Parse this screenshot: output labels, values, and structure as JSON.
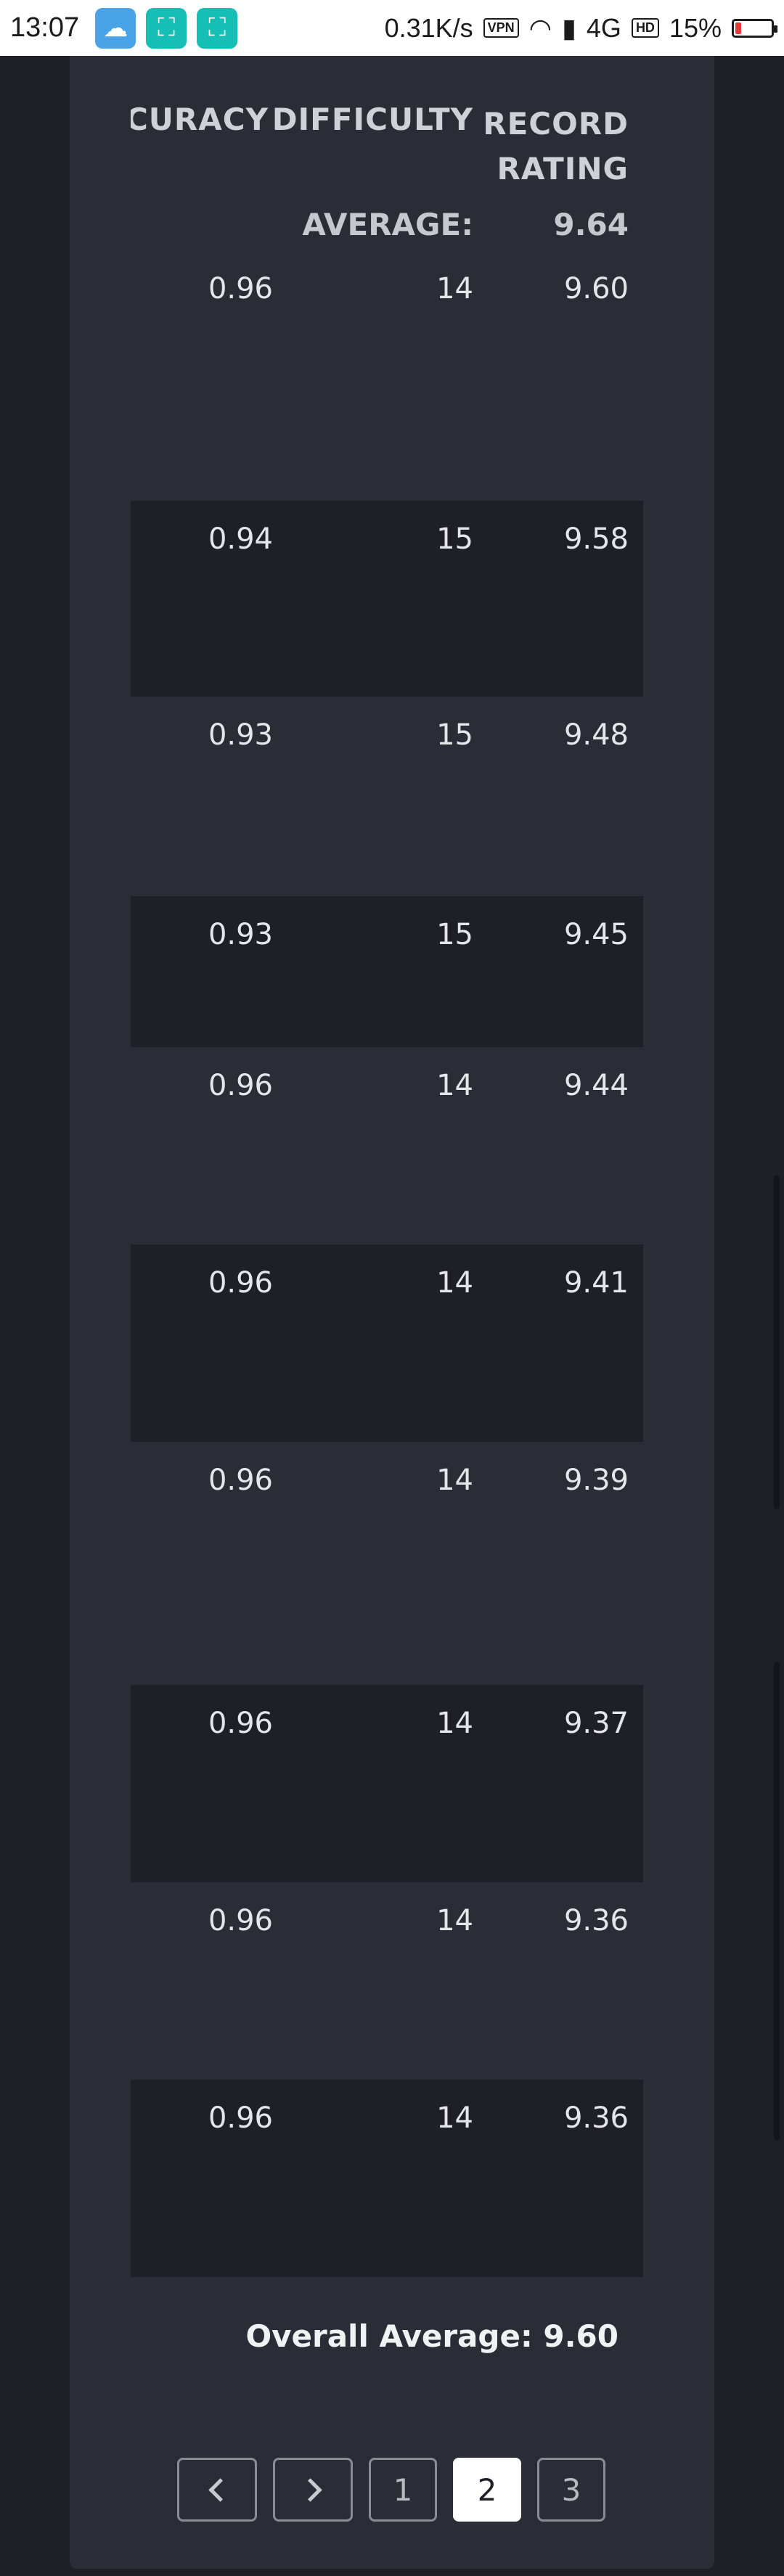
{
  "status_bar": {
    "time": "13:07",
    "speed": "0.31K/s",
    "vpn": "VPN",
    "network": "4G",
    "hd": "HD",
    "battery": "15%",
    "battery_level": 0.15
  },
  "table": {
    "headers": {
      "accuracy": "ACCURACY",
      "difficulty": "DIFFICULTY",
      "record_rating_line1": "RECORD",
      "record_rating_line2": "RATING"
    },
    "average": {
      "label": "AVERAGE:",
      "value": "9.64"
    },
    "rows": [
      {
        "accuracy": "0.96",
        "difficulty": "14",
        "rating": "9.60"
      },
      {
        "accuracy": "0.94",
        "difficulty": "15",
        "rating": "9.58"
      },
      {
        "accuracy": "0.93",
        "difficulty": "15",
        "rating": "9.48"
      },
      {
        "accuracy": "0.93",
        "difficulty": "15",
        "rating": "9.45"
      },
      {
        "accuracy": "0.96",
        "difficulty": "14",
        "rating": "9.44"
      },
      {
        "accuracy": "0.96",
        "difficulty": "14",
        "rating": "9.41"
      },
      {
        "accuracy": "0.96",
        "difficulty": "14",
        "rating": "9.39"
      },
      {
        "accuracy": "0.96",
        "difficulty": "14",
        "rating": "9.37"
      },
      {
        "accuracy": "0.96",
        "difficulty": "14",
        "rating": "9.36"
      },
      {
        "accuracy": "0.96",
        "difficulty": "14",
        "rating": "9.36"
      }
    ]
  },
  "overall_average": "Overall Average: 9.60",
  "pagination": {
    "pages": [
      "1",
      "2",
      "3"
    ],
    "current": "2"
  }
}
